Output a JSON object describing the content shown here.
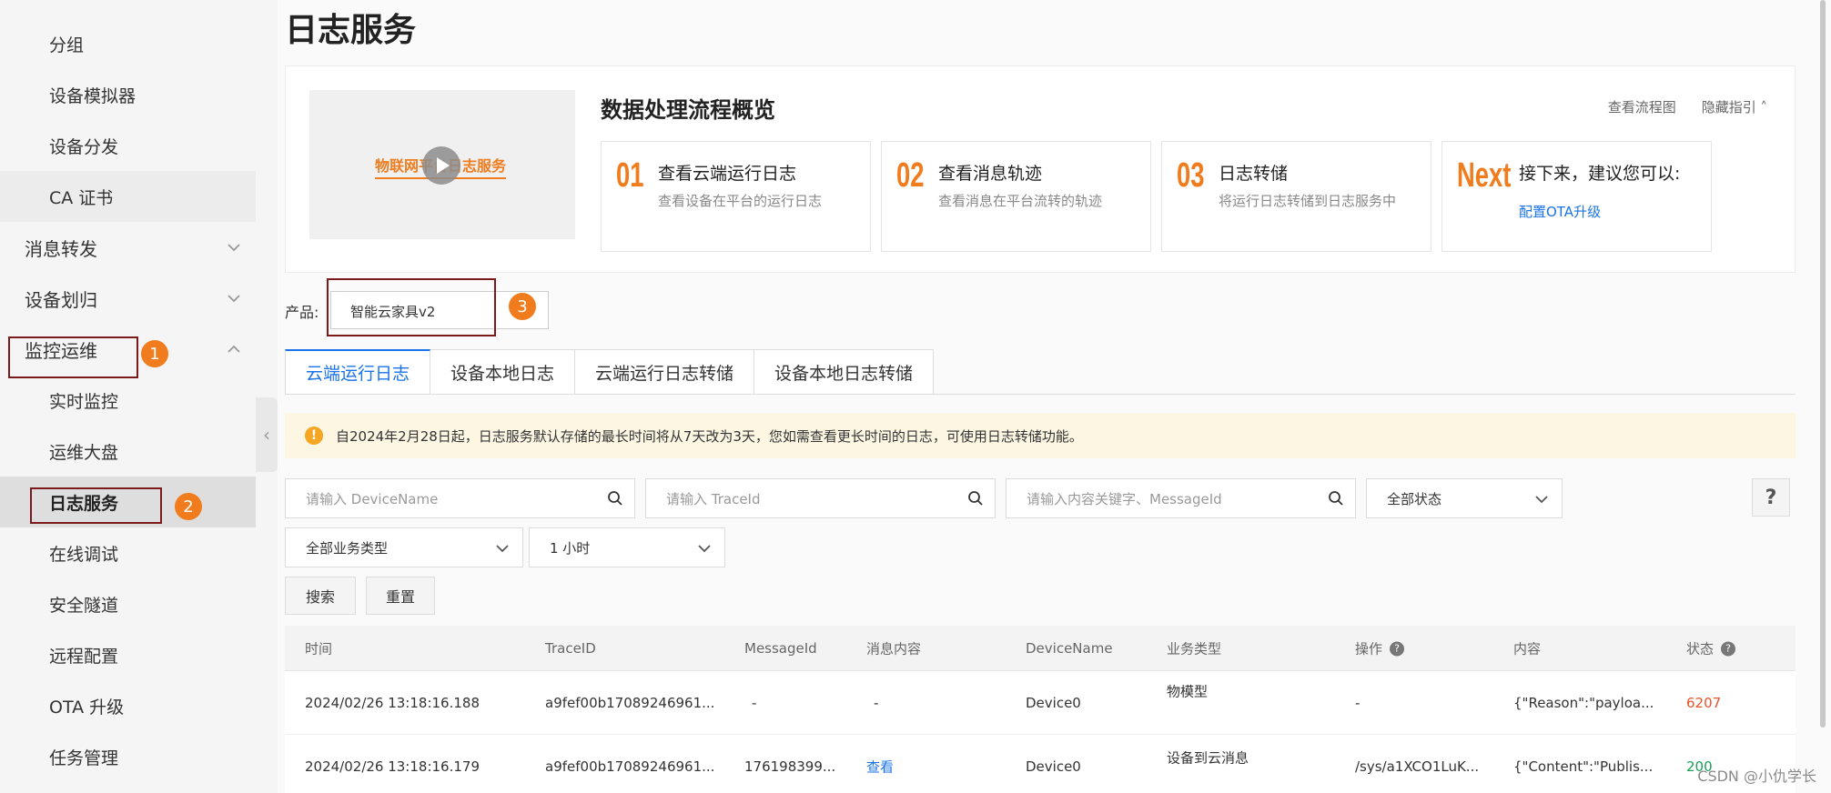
{
  "sidebar": {
    "truncated_top": "分组",
    "items": [
      {
        "label": "分组"
      },
      {
        "label": "设备模拟器"
      },
      {
        "label": "设备分发"
      },
      {
        "label": "CA 证书"
      }
    ],
    "groups": [
      {
        "label": "消息转发"
      },
      {
        "label": "设备划归"
      },
      {
        "label": "监控运维"
      }
    ],
    "ops_items": [
      {
        "label": "实时监控"
      },
      {
        "label": "运维大盘"
      },
      {
        "label": "日志服务"
      },
      {
        "label": "在线调试"
      },
      {
        "label": "安全隧道"
      },
      {
        "label": "远程配置"
      },
      {
        "label": "OTA 升级"
      },
      {
        "label": "任务管理"
      }
    ]
  },
  "annotations": [
    "1",
    "2",
    "3"
  ],
  "page": {
    "title": "日志服务"
  },
  "guide": {
    "video_text": "物联网平台日志服务",
    "title": "数据处理流程概览",
    "link_flow": "查看流程图",
    "link_hide": "隐藏指引",
    "steps": [
      {
        "num": "01",
        "title": "查看云端运行日志",
        "desc": "查看设备在平台的运行日志"
      },
      {
        "num": "02",
        "title": "查看消息轨迹",
        "desc": "查看消息在平台流转的轨迹"
      },
      {
        "num": "03",
        "title": "日志转储",
        "desc": "将运行日志转储到日志服务中"
      },
      {
        "num": "Next",
        "title": "接下来，建议您可以:",
        "link": "配置OTA升级"
      }
    ]
  },
  "product": {
    "label": "产品:",
    "value": "智能云家具v2"
  },
  "tabs": [
    {
      "label": "云端运行日志",
      "active": true
    },
    {
      "label": "设备本地日志"
    },
    {
      "label": "云端运行日志转储"
    },
    {
      "label": "设备本地日志转储"
    }
  ],
  "notice": "自2024年2月28日起，日志服务默认存储的最长时间将从7天改为3天，您如需查看更长时间的日志，可使用日志转储功能。",
  "filters": {
    "device_placeholder": "请输入 DeviceName",
    "trace_placeholder": "请输入 TraceId",
    "content_placeholder": "请输入内容关键字、MessageId",
    "status": "全部状态",
    "biz_type": "全部业务类型",
    "time_range": "1 小时",
    "search": "搜索",
    "reset": "重置",
    "help": "?"
  },
  "table": {
    "headers": [
      "时间",
      "TraceID",
      "MessageId",
      "消息内容",
      "DeviceName",
      "业务类型",
      "操作",
      "内容",
      "状态"
    ],
    "rows": [
      [
        "2024/02/26 13:18:16.188",
        "a9fef00b17089246961...",
        "-",
        "-",
        "Device0",
        "物模型",
        "-",
        "{\"Reason\":\"payloa...",
        "6207"
      ],
      [
        "2024/02/26 13:18:16.179",
        "a9fef00b17089246961...",
        "176198399...",
        "查看",
        "Device0",
        "设备到云消息",
        "/sys/a1XCO1LuK...",
        "{\"Content\":\"Publis...",
        "200"
      ]
    ]
  },
  "watermark": "CSDN @小仇学长",
  "colors": {
    "accent": "#1a73e8",
    "orange": "#f07c1e",
    "annotation": "#7a1a1a",
    "error": "#e8522b",
    "success": "#18a058"
  }
}
